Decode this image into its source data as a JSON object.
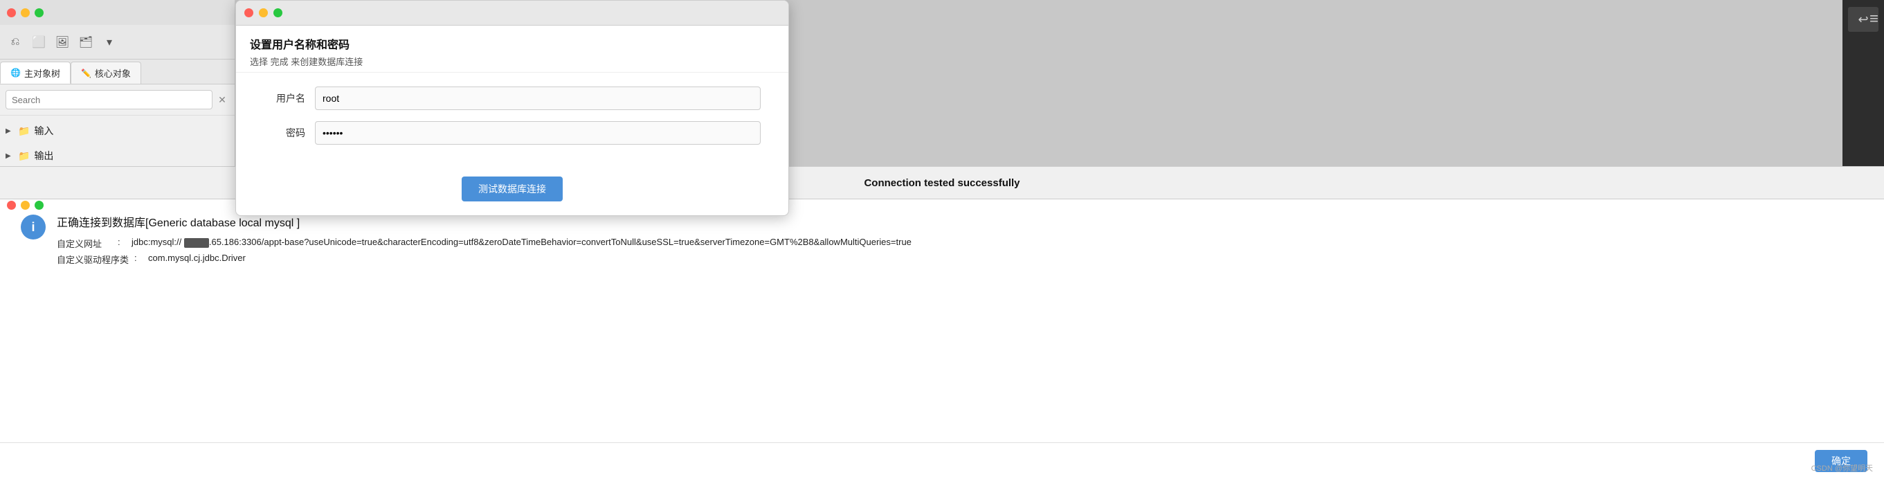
{
  "leftPanel": {
    "titleButtons": [
      "close",
      "minimize",
      "maximize"
    ],
    "tabs": [
      {
        "id": "main-tree",
        "label": "主对象树",
        "icon": "🌐",
        "active": true
      },
      {
        "id": "core-obj",
        "label": "核心对象",
        "icon": "✏️",
        "active": false
      }
    ],
    "search": {
      "placeholder": "Search",
      "value": ""
    },
    "treeItems": [
      {
        "id": "input",
        "label": "输入",
        "hasArrow": true
      },
      {
        "id": "output",
        "label": "输出",
        "hasArrow": true
      },
      {
        "id": "item3",
        "label": "",
        "hasArrow": true
      }
    ]
  },
  "topDialog": {
    "title": "设置用户名称和密码",
    "subtitle": "选择 完成 来创建数据库连接",
    "fields": [
      {
        "id": "username",
        "label": "用户名",
        "value": "root",
        "type": "text"
      },
      {
        "id": "password",
        "label": "密码",
        "value": "******",
        "type": "password"
      }
    ],
    "testButton": "测试数据库连接"
  },
  "toolbar": {
    "icons": [
      "↩",
      "≡"
    ]
  },
  "successBar": {
    "title": "Connection tested successfully"
  },
  "successDialog": {
    "icon": "i",
    "mainText": "正确连接到数据库[Generic database local mysql ]",
    "details": [
      {
        "label": "自定义网址",
        "separator": ":",
        "prefix": "jdbc:mysql://",
        "blurred": true,
        "suffix": ".65.186:3306/appt-base?useUnicode=true&characterEncoding=utf8&zeroDateTimeBehavior=convertToNull&useSSL=true&serverTimezone=GMT%2B8&allowMultiQueries=true"
      },
      {
        "label": "自定义驱动程序类",
        "separator": ":",
        "value": "com.mysql.cj.jdbc.Driver"
      }
    ],
    "confirmButton": "确定",
    "watermark": "CSDN @你望明天"
  }
}
